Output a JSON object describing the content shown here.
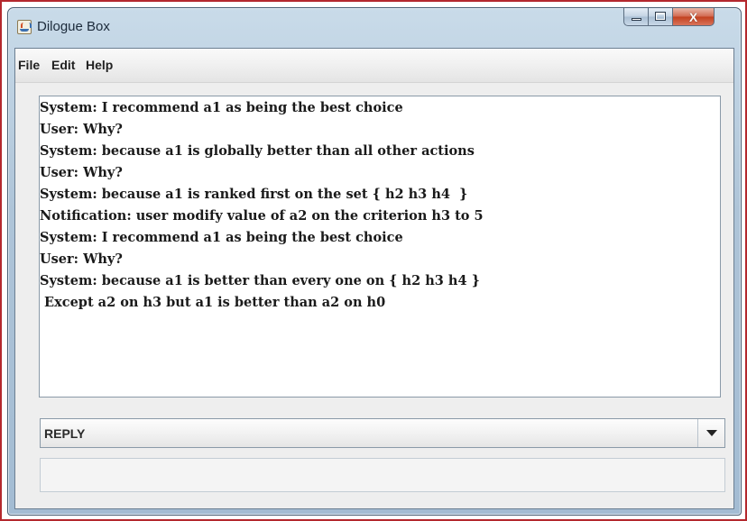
{
  "window": {
    "title": "Dilogue Box",
    "close_glyph": "X"
  },
  "menubar": {
    "items": [
      "File",
      "Edit",
      "Help"
    ]
  },
  "dialogue": {
    "lines": [
      "System: I recommend a1 as being the best choice",
      "User: Why?",
      "System: because a1 is globally better than all other actions",
      "User: Why?",
      "System: because a1 is ranked first on the set { h2 h3 h4  }",
      "Notification: user modify value of a2 on the criterion h3 to 5",
      "System: I recommend a1 as being the best choice",
      "User: Why?",
      "System: because a1 is better than every one on { h2 h3 h4 }",
      " Except a2 on h3 but a1 is better than a2 on h0"
    ]
  },
  "reply_combo": {
    "selected": "REPLY"
  },
  "reply_input": {
    "value": ""
  },
  "icons": {
    "app": "java-app-icon",
    "minimize": "minimize-icon",
    "maximize": "maximize-icon",
    "close": "close-icon",
    "dropdown": "chevron-down-icon"
  },
  "colors": {
    "frame_border": "#b4282d",
    "close_button": "#c2411f"
  }
}
